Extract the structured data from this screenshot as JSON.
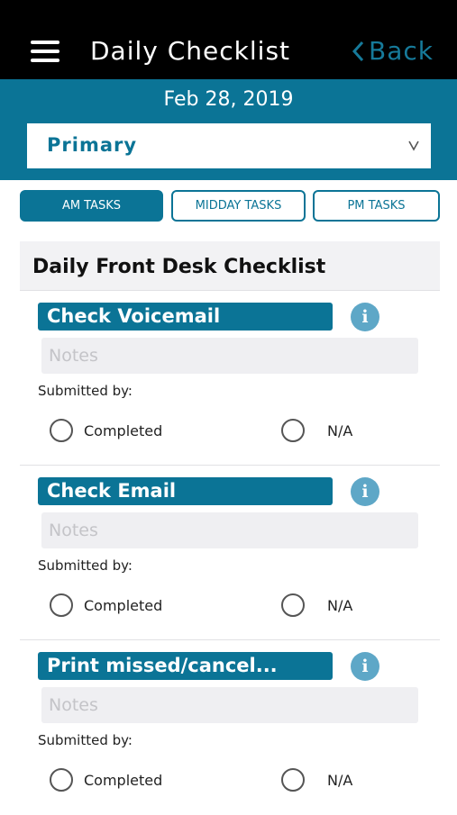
{
  "header": {
    "title": "Daily Checklist",
    "back_label": "Back",
    "menu_icon": "hamburger-menu-icon",
    "back_icon": "chevron-left-icon"
  },
  "date": "Feb 28, 2019",
  "location_select": {
    "value": "Primary",
    "icon": "chevron-down-icon"
  },
  "tabs": [
    {
      "label": "AM TASKS",
      "active": true
    },
    {
      "label": "MIDDAY TASKS",
      "active": false
    },
    {
      "label": "PM TASKS",
      "active": false
    }
  ],
  "checklist": {
    "title": "Daily Front Desk Checklist",
    "items": [
      {
        "title": "Check Voicemail",
        "notes_placeholder": "Notes",
        "submitted_label": "Submitted by:",
        "option_completed": "Completed",
        "option_na": "N/A",
        "info_icon": "i"
      },
      {
        "title": "Check Email",
        "notes_placeholder": "Notes",
        "submitted_label": "Submitted by:",
        "option_completed": "Completed",
        "option_na": "N/A",
        "info_icon": "i"
      },
      {
        "title": "Print missed/cancel...",
        "notes_placeholder": "Notes",
        "submitted_label": "Submitted by:",
        "option_completed": "Completed",
        "option_na": "N/A",
        "info_icon": "i"
      }
    ]
  },
  "colors": {
    "header_bg": "#000000",
    "accent": "#0b7496",
    "info_bg": "#5ea7c7",
    "back_text": "#167a9a"
  }
}
